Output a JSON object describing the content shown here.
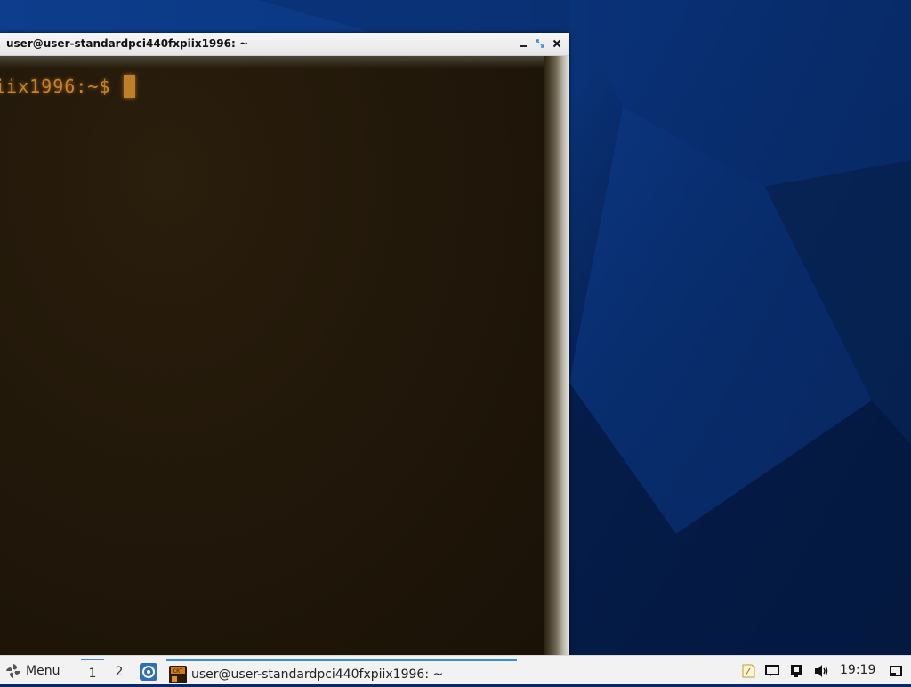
{
  "window": {
    "title": "user@user-standardpci440fxpiix1996: ~"
  },
  "terminal": {
    "prompt": "iix1996:~$ "
  },
  "taskbar": {
    "menu_label": "Menu",
    "workspaces": [
      "1",
      "2"
    ],
    "active_workspace": "1",
    "task_label": "user@user-standardpci440fxpiix1996: ~",
    "clock": "19:19"
  },
  "icons": {
    "menu": "menu-icon",
    "launcher": "web-browser-icon",
    "task": "crt-terminal-icon",
    "tray": [
      "notes-icon",
      "chat-icon",
      "display-icon",
      "volume-icon",
      "show-desktop-icon"
    ]
  },
  "colors": {
    "accent": "#3b8fd9",
    "terminal_text": "#c8832a",
    "terminal_bg": "#1c1408"
  }
}
